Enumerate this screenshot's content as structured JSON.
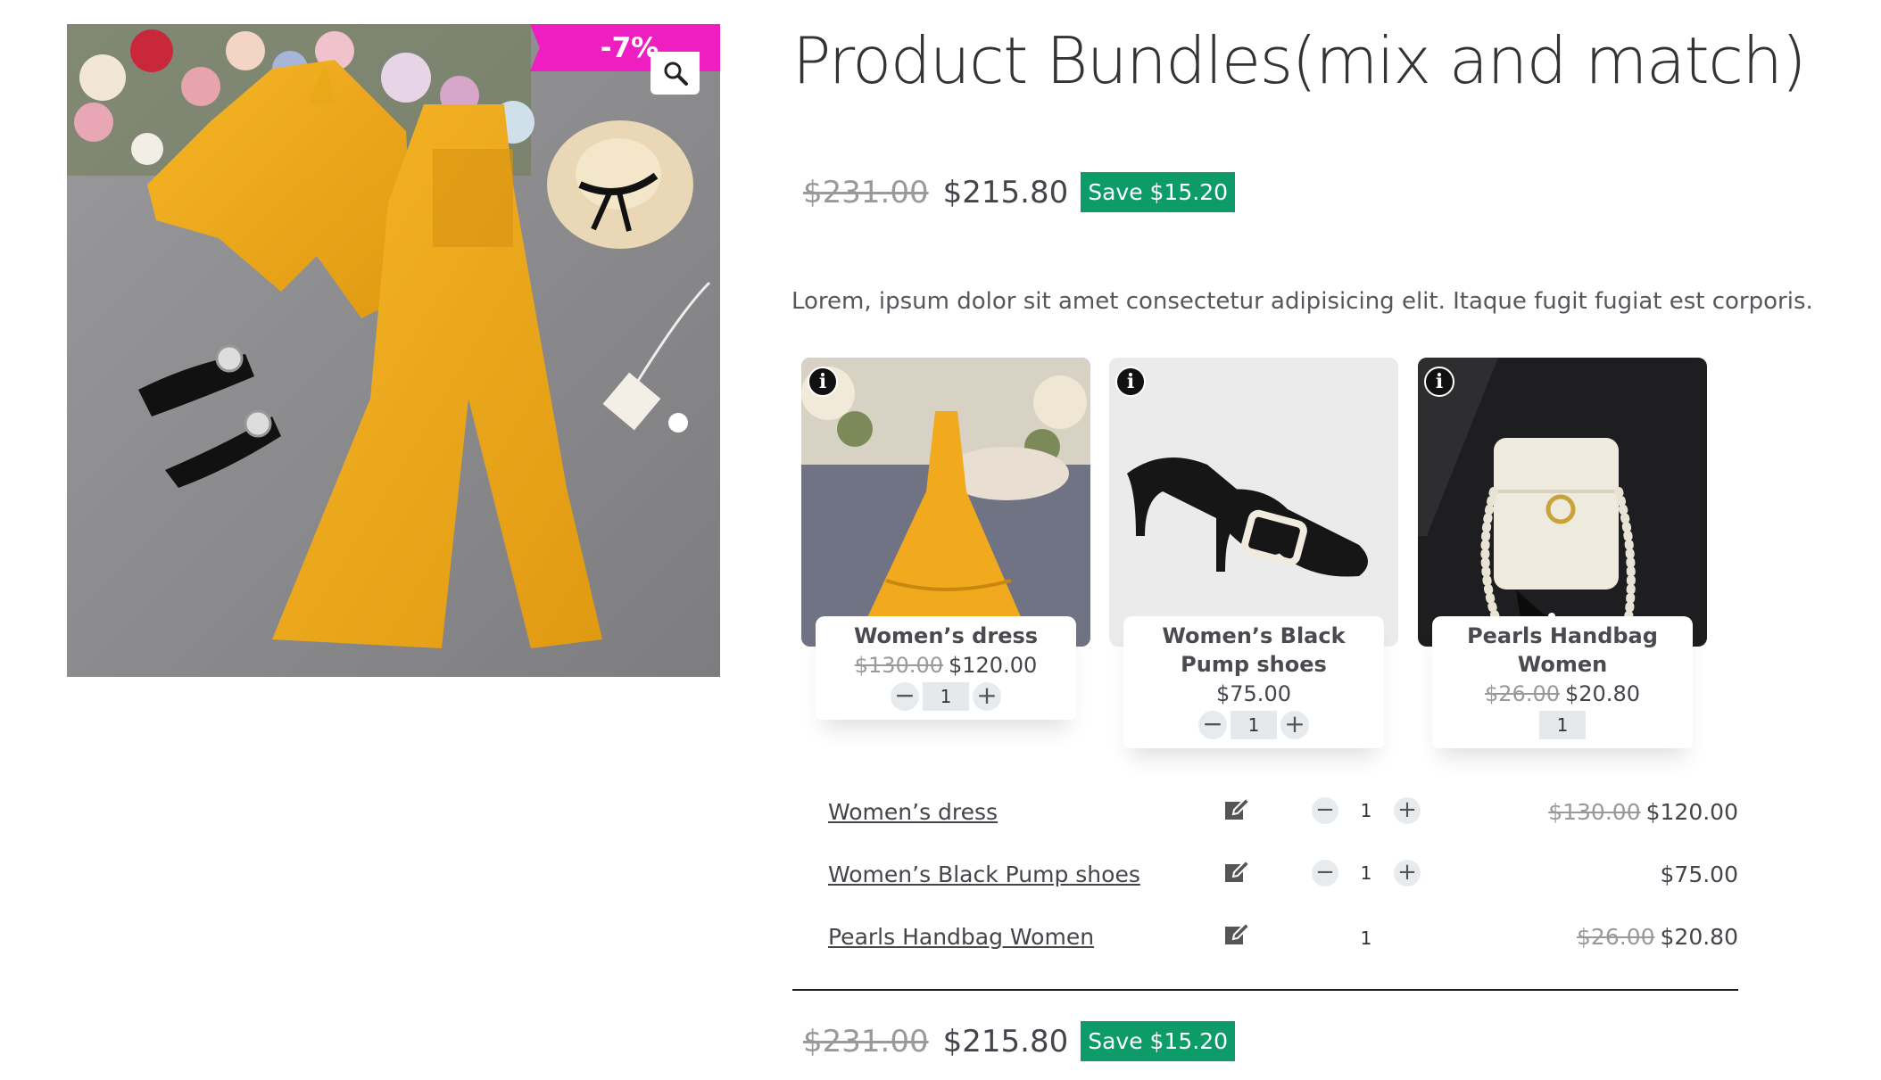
{
  "gallery": {
    "sale_badge": "-7%",
    "zoom_icon": "magnifier-icon",
    "image_alt": "Yellow outfit flat lay with shoes, hat and bag"
  },
  "product": {
    "title": "Product Bundles(mix and match)",
    "price_old": "$231.00",
    "price_new": "$215.80",
    "save_label": "Save $15.20",
    "description": "Lorem, ipsum dolor sit amet consectetur adipisicing elit. Itaque fugit fugiat est corporis."
  },
  "bundle_cards": [
    {
      "name": "Women’s dress",
      "price_old": "$130.00",
      "price_new": "$120.00",
      "qty": "1",
      "has_stepper": true,
      "info_icon": "info-icon"
    },
    {
      "name": "Women’s Black Pump shoes",
      "price_old": "",
      "price_new": "$75.00",
      "qty": "1",
      "has_stepper": true,
      "info_icon": "info-icon"
    },
    {
      "name": "Pearls Handbag Women",
      "price_old": "$26.00",
      "price_new": "$20.80",
      "qty": "1",
      "has_stepper": false,
      "info_icon": "info-icon"
    }
  ],
  "bundle_table": [
    {
      "name": "Women’s dress",
      "qty": "1",
      "price_old": "$130.00",
      "price_new": "$120.00",
      "edit_icon": "edit-icon"
    },
    {
      "name": "Women’s Black Pump shoes",
      "qty": "1",
      "price_old": "",
      "price_new": "$75.00",
      "edit_icon": "edit-icon"
    },
    {
      "name": "Pearls Handbag Women",
      "qty": "1",
      "price_old": "$26.00",
      "price_new": "$20.80",
      "edit_icon": "edit-icon"
    }
  ],
  "totals": {
    "price_old": "$231.00",
    "price_new": "$215.80",
    "save_label": "Save $15.20"
  },
  "stepper": {
    "minus": "−",
    "plus": "+"
  },
  "colors": {
    "sale_badge": "#ee1ec1",
    "save_badge": "#0e9b6a",
    "text": "#43454b"
  }
}
